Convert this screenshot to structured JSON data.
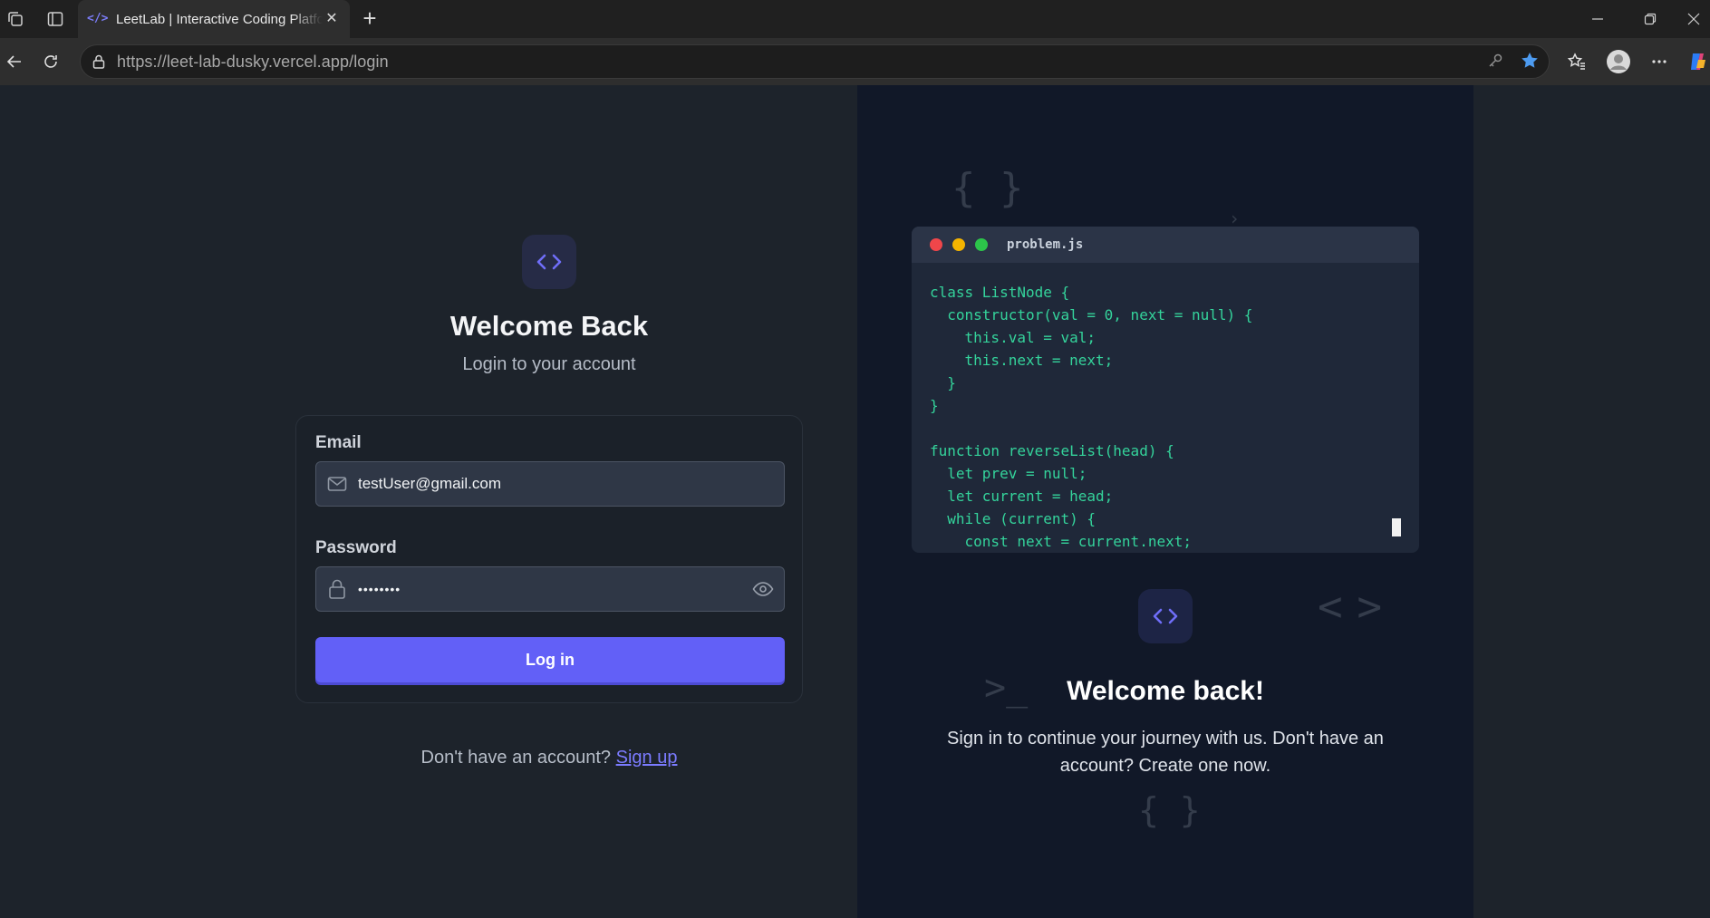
{
  "browser": {
    "tab_title": "LeetLab | Interactive Coding Platform",
    "url_host": "https://leet-lab-dusky.vercel.app",
    "url_path": "/login",
    "new_tab": "+",
    "close": "✕"
  },
  "login": {
    "heading": "Welcome Back",
    "subheading": "Login to your account",
    "email_label": "Email",
    "email_value": "testUser@gmail.com",
    "password_label": "Password",
    "password_value": "••••••••",
    "login_button": "Log in",
    "no_account": "Don't have an account?",
    "signup_link": "Sign up"
  },
  "promo": {
    "file_name": "problem.js",
    "code": "class ListNode {\n  constructor(val = 0, next = null) {\n    this.val = val;\n    this.next = next;\n  }\n}\n\nfunction reverseList(head) {\n  let prev = null;\n  let current = head;\n  while (current) {\n    const next = current.next;",
    "heading": "Welcome back!",
    "text": "Sign in to continue your journey with us. Don't have an account? Create one now.",
    "deco_braces": "{ }",
    "deco_chevrons": "< >",
    "deco_prompt": ">_"
  },
  "colors": {
    "accent": "#6260f7",
    "code_green": "#34d39b",
    "dot_red": "#f0464a",
    "dot_yellow": "#f4b400",
    "dot_green": "#2cc54a"
  }
}
